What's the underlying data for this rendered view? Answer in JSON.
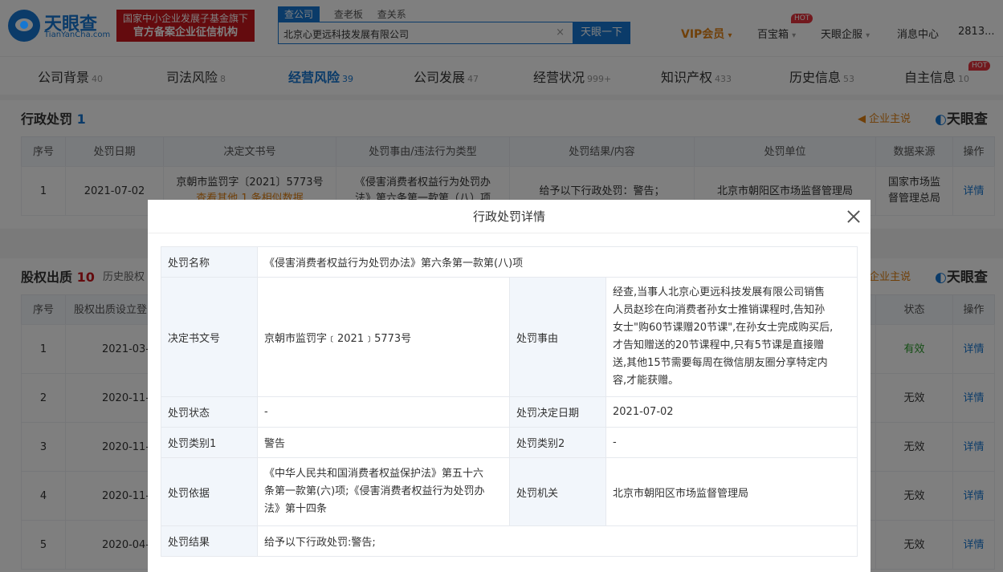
{
  "header": {
    "logo_cn": "天眼查",
    "logo_en": "TianYanCha.com",
    "badge_line1": "国家中小企业发展子基金旗下",
    "badge_line2": "官方备案企业征信机构",
    "search_tabs": [
      "查公司",
      "查老板",
      "查关系"
    ],
    "search_value": "北京心更远科技发展有限公司",
    "search_button": "天眼一下",
    "vip": "VIP会员",
    "baibao": "百宝箱",
    "hot": "HOT",
    "qifu": "天眼企服",
    "msg": "消息中心",
    "user": "2813..."
  },
  "categories": [
    {
      "label": "公司背景",
      "count": "40"
    },
    {
      "label": "司法风险",
      "count": "8"
    },
    {
      "label": "经营风险",
      "count": "39"
    },
    {
      "label": "公司发展",
      "count": "47"
    },
    {
      "label": "经营状况",
      "count": "999+"
    },
    {
      "label": "知识产权",
      "count": "433"
    },
    {
      "label": "历史信息",
      "count": "53"
    },
    {
      "label": "自主信息",
      "count": "10"
    }
  ],
  "penalty": {
    "title": "行政处罚",
    "count": "1",
    "ad": "企业主说",
    "tyc": "天眼查",
    "headers": [
      "序号",
      "处罚日期",
      "决定文书号",
      "处罚事由/违法行为类型",
      "处罚结果/内容",
      "处罚单位",
      "数据来源",
      "操作"
    ],
    "row": {
      "no": "1",
      "date": "2021-07-02",
      "doc": "京朝市监罚字〔2021〕5773号",
      "doc_extra": "查看其他 1 条相似数据",
      "reason": "《侵害消费者权益行为处罚办",
      "reason2": "法》第六条第一款第（八）项",
      "result": "给予以下行政处罚：警告；",
      "unit": "北京市朝阳区市场监督管理局",
      "source1": "国家市场监",
      "source2": "督管理总局",
      "action": "详情"
    }
  },
  "pledge": {
    "title": "股权出质",
    "count": "10",
    "sub": "历史股权",
    "ad": "企业主说",
    "tyc": "天眼查",
    "headers": [
      "序号",
      "股权出质设立登",
      "状态",
      "操作"
    ],
    "rows": [
      {
        "no": "1",
        "date": "2021-03-",
        "status": "有效",
        "action": "详情"
      },
      {
        "no": "2",
        "date": "2020-11-",
        "status": "无效",
        "action": "详情"
      },
      {
        "no": "3",
        "date": "2020-11-",
        "status": "无效",
        "action": "详情"
      },
      {
        "no": "4",
        "date": "2020-11-",
        "status": "无效",
        "action": "详情"
      },
      {
        "no": "5",
        "date": "2020-04-",
        "status": "无效",
        "action": "详情"
      }
    ]
  },
  "modal": {
    "title": "行政处罚详情",
    "name_label": "处罚名称",
    "name_value": "《侵害消费者权益行为处罚办法》第六条第一款第(八)项",
    "doc_label": "决定书文号",
    "doc_value": "京朝市监罚字﹝2021﹞5773号",
    "reason_label": "处罚事由",
    "reason_lines": [
      "经查,当事人北京心更远科技发展有限公司销售",
      "人员赵珍在向消费者孙女士推销课程时,告知孙",
      "女士\"购60节课赠20节课\",在孙女士完成购买后,",
      "才告知赠送的20节课程中,只有5节课是直接赠",
      "送,其他15节需要每周在微信朋友圈分享特定内",
      "容,才能获赠。"
    ],
    "status_label": "处罚状态",
    "status_value": "-",
    "date_label": "处罚决定日期",
    "date_value": "2021-07-02",
    "type1_label": "处罚类别1",
    "type1_value": "警告",
    "type2_label": "处罚类别2",
    "type2_value": "-",
    "basis_label": "处罚依据",
    "basis_lines": [
      "《中华人民共和国消费者权益保护法》第五十六",
      "条第一款第(六)项;《侵害消费者权益行为处罚办",
      "法》第十四条"
    ],
    "org_label": "处罚机关",
    "org_value": "北京市朝阳区市场监督管理局",
    "result_label": "处罚结果",
    "result_value": "给予以下行政处罚:警告;"
  }
}
